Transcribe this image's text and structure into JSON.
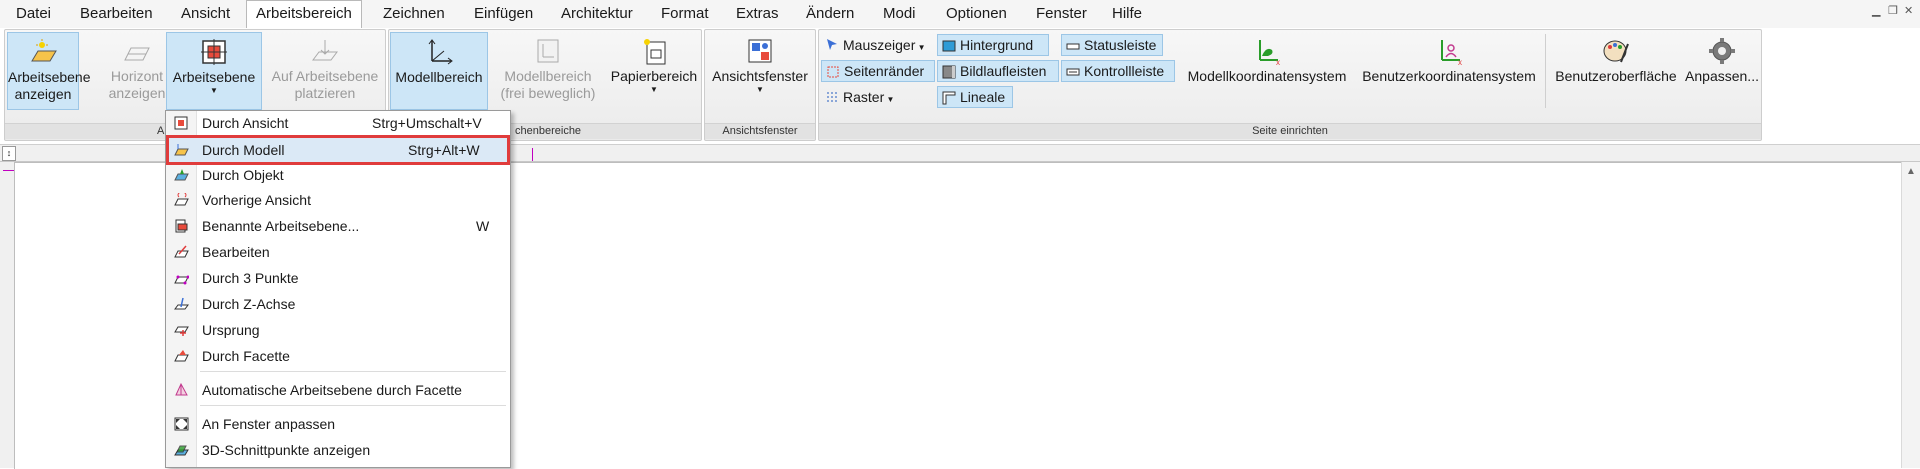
{
  "menu": [
    "Datei",
    "Bearbeiten",
    "Ansicht",
    "Arbeitsbereich",
    "Zeichnen",
    "Einfügen",
    "Architektur",
    "Format",
    "Extras",
    "Ändern",
    "Modi",
    "Optionen",
    "Fenster",
    "Hilfe"
  ],
  "window_controls": {
    "minimize": "▁",
    "restore": "❐",
    "close": "✕"
  },
  "ribbon": {
    "group1": {
      "label_fragment": "A",
      "arbeitsebene_anzeigen": [
        "Arbeitsebene",
        "anzeigen"
      ],
      "horizont_anzeigen": [
        "Horizont",
        "anzeigen"
      ],
      "arbeitsebene": "Arbeitsebene",
      "auf_arbeitsebene_platzieren": [
        "Auf Arbeitsebene",
        "platzieren"
      ]
    },
    "group2": {
      "label_fragment": "chenbereiche",
      "modellbereich": "Modellbereich",
      "modellbereich_frei": [
        "Modellbereich",
        "(frei beweglich)"
      ],
      "papierbereich": "Papierbereich"
    },
    "group3": {
      "label": "Ansichtsfenster",
      "ansichtsfenster": "Ansichtsfenster"
    },
    "group4": {
      "label": "Seite einrichten",
      "mauszeiger": "Mauszeiger",
      "seitenraender": "Seitenränder",
      "raster": "Raster",
      "hintergrund": "Hintergrund",
      "bildlaufleisten": "Bildlaufleisten",
      "lineale": "Lineale",
      "statusleiste": "Statusleiste",
      "kontrollleiste": "Kontrollleiste",
      "modellkoordinatensystem": "Modellkoordinatensystem",
      "benutzerkoordinatensystem": "Benutzerkoordinatensystem",
      "benutzeroberflaeche": "Benutzeroberfläche",
      "anpassen": "Anpassen..."
    }
  },
  "dropdown": {
    "items": [
      {
        "label": "Durch Ansicht",
        "shortcut": "Strg+Umschalt+V",
        "icon": "view-plane-icon"
      },
      {
        "label": "Durch Modell",
        "shortcut": "Strg+Alt+W",
        "icon": "model-plane-icon",
        "highlighted": true
      },
      {
        "label": "Durch Objekt",
        "shortcut": "",
        "icon": "object-plane-icon"
      },
      {
        "label": "Vorherige Ansicht",
        "shortcut": "",
        "icon": "previous-view-icon"
      },
      {
        "label": "Benannte Arbeitsebene...",
        "shortcut": "W",
        "icon": "named-plane-icon"
      },
      {
        "label": "Bearbeiten",
        "shortcut": "",
        "icon": "edit-plane-icon"
      },
      {
        "label": "Durch 3 Punkte",
        "shortcut": "",
        "icon": "three-points-icon"
      },
      {
        "label": "Durch Z-Achse",
        "shortcut": "",
        "icon": "z-axis-icon"
      },
      {
        "label": "Ursprung",
        "shortcut": "",
        "icon": "origin-icon"
      },
      {
        "label": "Durch Facette",
        "shortcut": "",
        "icon": "facet-icon"
      },
      {
        "label": "Automatische Arbeitsebene durch Facette",
        "shortcut": "",
        "icon": "auto-facet-icon"
      },
      {
        "label": "An Fenster anpassen",
        "shortcut": "",
        "icon": "fit-window-icon"
      },
      {
        "label": "3D-Schnittpunkte anzeigen",
        "shortcut": "",
        "icon": "intersections-3d-icon"
      }
    ]
  },
  "colors": {
    "accent_selected": "#cde6f7",
    "highlight_border": "#e03c3c"
  }
}
